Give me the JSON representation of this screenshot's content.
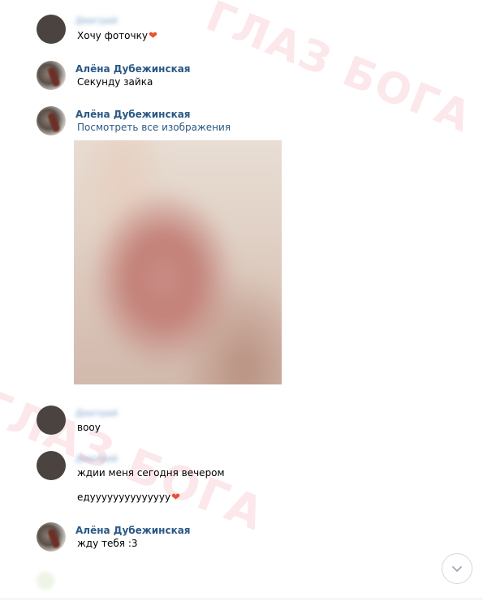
{
  "messages": [
    {
      "sender": "Дмитрий",
      "lines": [
        "Хочу фоточку"
      ],
      "heart_after_line": 0
    },
    {
      "sender": "Алёна Дубежинская",
      "lines": [
        "Секунду зайка"
      ]
    },
    {
      "sender": "Алёна Дубежинская",
      "link": "Посмотреть все изображения",
      "has_photo": true
    },
    {
      "sender": "Дмитрий",
      "lines": [
        "вооу"
      ]
    },
    {
      "sender": "Дмитрий",
      "lines": [
        "ждии меня сегодня вечером",
        "едуууууууууууууу"
      ],
      "heart_after_line": 1
    },
    {
      "sender": "Алёна Дубежинская",
      "lines": [
        "жду тебя :3"
      ]
    }
  ],
  "watermark": {
    "text": "ГЛАЗ БОГА",
    "color": "#eb465a"
  },
  "icons": {
    "heart": "heart-emoji-icon",
    "scroll_down": "chevron-down-icon"
  },
  "colors": {
    "name_link": "#2a5885",
    "background": "#ffffff"
  }
}
